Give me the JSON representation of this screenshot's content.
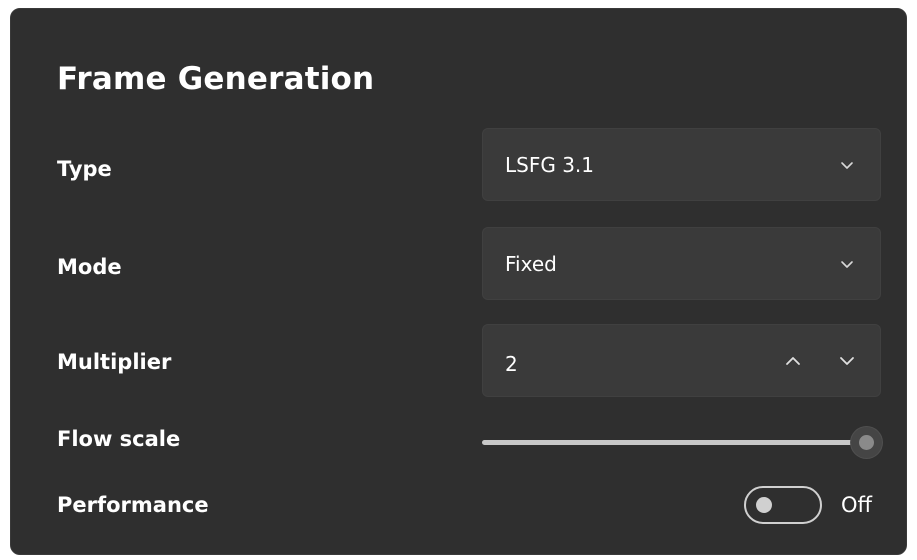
{
  "panel": {
    "title": "Frame Generation"
  },
  "type_setting": {
    "label": "Type",
    "value": "LSFG 3.1",
    "icon": "chevron-down-icon"
  },
  "mode_setting": {
    "label": "Mode",
    "value": "Fixed",
    "icon": "chevron-down-icon"
  },
  "multiplier_setting": {
    "label": "Multiplier",
    "value": "2",
    "up_icon": "chevron-up-icon",
    "down_icon": "chevron-down-icon"
  },
  "flow_scale_setting": {
    "label": "Flow scale",
    "value_fraction": 1.0
  },
  "performance_setting": {
    "label": "Performance",
    "state": "Off"
  },
  "colors": {
    "panel_background": "#2f2f2f",
    "control_background": "#3a3a3a",
    "text": "#ffffff",
    "slider_track": "#c8c8c8"
  }
}
